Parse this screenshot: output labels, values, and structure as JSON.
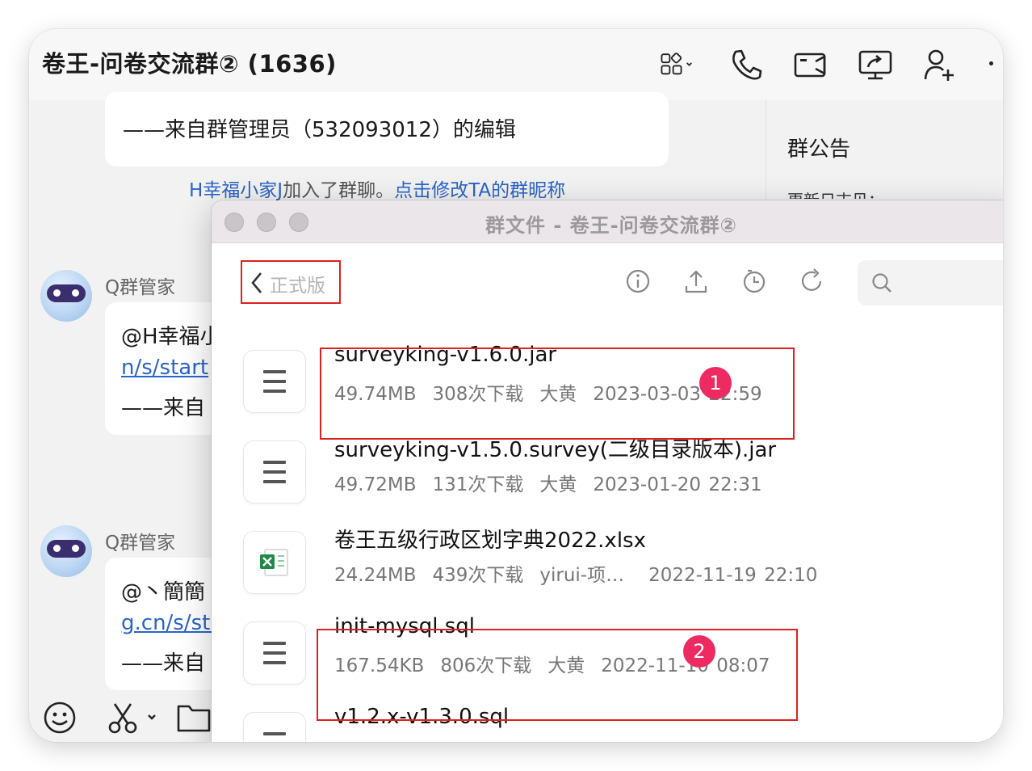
{
  "header": {
    "title": "卷王-问卷交流群② (1636)"
  },
  "chat": {
    "top_bubble_text": "——来自群管理员（532093012）的编辑",
    "system_line": {
      "member": "H幸福小家J",
      "joined": "加入了群聊。",
      "action": "点击修改TA的群昵称"
    },
    "messages": [
      {
        "sender": "Q群管家",
        "line1": "@H幸福小",
        "line2": "n/s/start",
        "line3": "——来自"
      },
      {
        "sender": "Q群管家",
        "line1": "@丶簡簡",
        "line2": "g.cn/s/sta",
        "line3": "——来自"
      }
    ]
  },
  "right_panel": {
    "title": "群公告",
    "subtitle": "更新日志见："
  },
  "file_window": {
    "title": "群文件 - 卷王-问卷交流群②",
    "back_label": "正式版",
    "files": [
      {
        "name": "surveyking-v1.6.0.jar",
        "size": "49.74MB",
        "downloads": "308次下载",
        "uploader": "大黄",
        "date": "2023-03-03 22:59",
        "icon": "file-generic-icon"
      },
      {
        "name": "surveyking-v1.5.0.survey(二级目录版本).jar",
        "size": "49.72MB",
        "downloads": "131次下载",
        "uploader": "大黄",
        "date": "2023-01-20 22:31",
        "icon": "file-generic-icon"
      },
      {
        "name": "卷王五级行政区划字典2022.xlsx",
        "size": "24.24MB",
        "downloads": "439次下载",
        "uploader": "yirui-项…",
        "date": "2022-11-19 22:10",
        "icon": "excel-icon"
      },
      {
        "name": "init-mysql.sql",
        "size": "167.54KB",
        "downloads": "806次下载",
        "uploader": "大黄",
        "date": "2022-11-10 08:07",
        "icon": "file-generic-icon"
      },
      {
        "name": "v1.2.x-v1.3.0.sql",
        "size": "",
        "downloads": "",
        "uploader": "",
        "date": "",
        "icon": "file-generic-icon"
      }
    ],
    "badges": [
      "1",
      "2"
    ]
  },
  "colors": {
    "highlight_red": "#e02020",
    "badge_pink": "#ee2a63",
    "link_blue": "#2b64c9"
  }
}
